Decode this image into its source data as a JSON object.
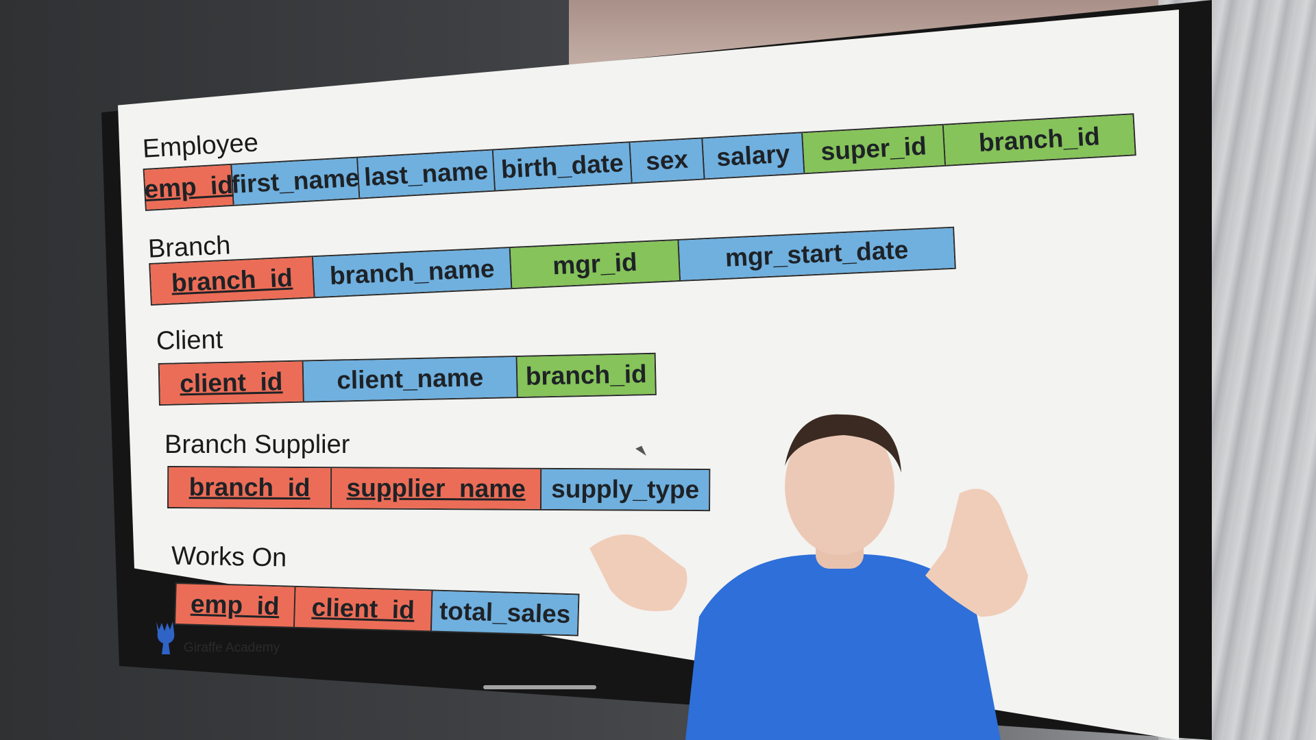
{
  "tables": [
    {
      "title": "Employee",
      "columns": [
        {
          "name": "emp_id",
          "kind": "primary-key"
        },
        {
          "name": "first_name",
          "kind": "attribute"
        },
        {
          "name": "last_name",
          "kind": "attribute"
        },
        {
          "name": "birth_date",
          "kind": "attribute"
        },
        {
          "name": "sex",
          "kind": "attribute"
        },
        {
          "name": "salary",
          "kind": "attribute"
        },
        {
          "name": "super_id",
          "kind": "foreign-key"
        },
        {
          "name": "branch_id",
          "kind": "foreign-key"
        }
      ]
    },
    {
      "title": "Branch",
      "columns": [
        {
          "name": "branch_id",
          "kind": "primary-key"
        },
        {
          "name": "branch_name",
          "kind": "attribute"
        },
        {
          "name": "mgr_id",
          "kind": "foreign-key"
        },
        {
          "name": "mgr_start_date",
          "kind": "attribute"
        }
      ]
    },
    {
      "title": "Client",
      "columns": [
        {
          "name": "client_id",
          "kind": "primary-key"
        },
        {
          "name": "client_name",
          "kind": "attribute"
        },
        {
          "name": "branch_id",
          "kind": "foreign-key"
        }
      ]
    },
    {
      "title": "Branch Supplier",
      "columns": [
        {
          "name": "branch_id",
          "kind": "primary-key"
        },
        {
          "name": "supplier_name",
          "kind": "primary-key"
        },
        {
          "name": "supply_type",
          "kind": "attribute"
        }
      ]
    },
    {
      "title": "Works On",
      "columns": [
        {
          "name": "emp_id",
          "kind": "primary-key"
        },
        {
          "name": "client_id",
          "kind": "primary-key"
        },
        {
          "name": "total_sales",
          "kind": "attribute"
        }
      ]
    }
  ],
  "colors": {
    "primary_key": "#ec6d57",
    "attribute": "#6fb0df",
    "foreign_key": "#86c35a"
  },
  "logo": {
    "text": "Giraffe Academy",
    "icon": "giraffe-icon"
  }
}
